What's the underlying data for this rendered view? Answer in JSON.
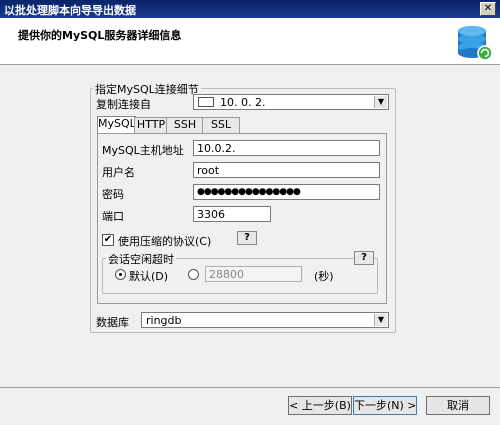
{
  "window": {
    "title": "以批处理脚本向导导出数据"
  },
  "header": {
    "title": "提供你的MySQL服务器详细信息",
    "icon": "database-refresh-icon"
  },
  "group": {
    "legend": "指定MySQL连接细节"
  },
  "copy_from": {
    "label": "复制连接自",
    "value": "10. 0. 2."
  },
  "tabs": [
    "MySQL",
    "HTTP",
    "SSH",
    "SSL"
  ],
  "host": {
    "label": "MySQL主机地址",
    "value": "10.0.2."
  },
  "user": {
    "label": "用户名",
    "value": "root"
  },
  "password": {
    "label": "密码",
    "value": "●●●●●●●●●●●●●●●"
  },
  "port": {
    "label": "端口",
    "value": "3306"
  },
  "compression": {
    "label": "使用压缩的协议(C)",
    "checked": true,
    "help": "?"
  },
  "idle": {
    "legend": "会话空闲超时",
    "help": "?",
    "default_label": "默认(D)",
    "custom_value": "28800",
    "unit": "(秒)"
  },
  "database": {
    "label": "数据库",
    "value": "ringdb"
  },
  "buttons": {
    "back": "< 上一步(B)",
    "next": "下一步(N) >",
    "cancel": "取消"
  }
}
